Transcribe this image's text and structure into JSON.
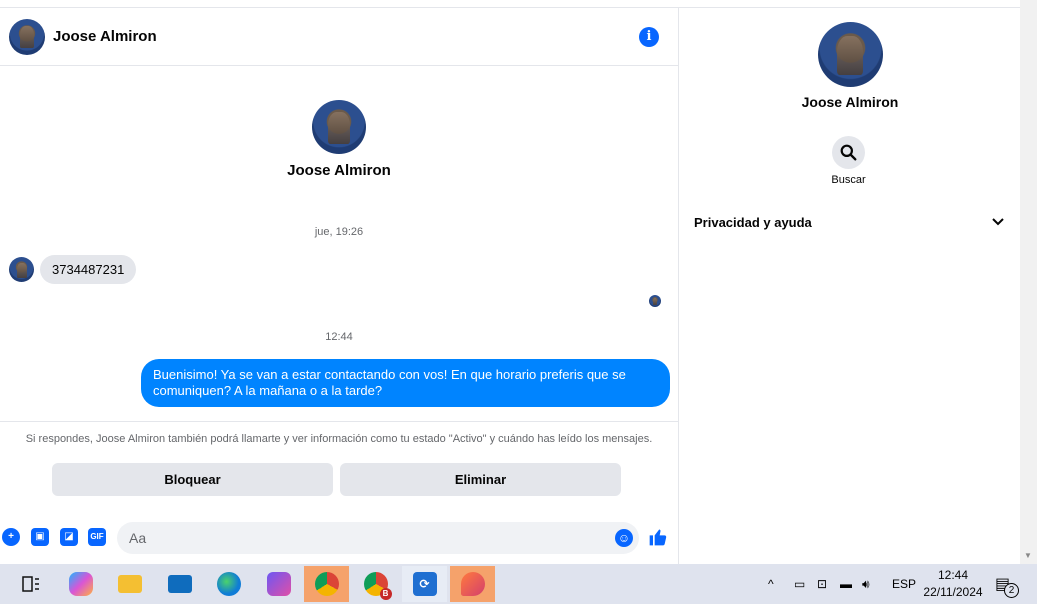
{
  "chat": {
    "contact_name": "Joose Almiron",
    "profile_name": "Joose Almiron",
    "timestamp_1": "jue, 19:26",
    "incoming_message": "3734487231",
    "timestamp_2": "12:44",
    "outgoing_message": "Buenisimo! Ya se van a estar contactando con vos! En que horario preferis que se comuniquen? A la mañana o a la tarde?",
    "notice": "Si respondes, Joose Almiron también podrá llamarte y ver información como tu estado \"Activo\" y cuándo has leído los mensajes.",
    "block_label": "Bloquear",
    "delete_label": "Eliminar",
    "input_placeholder": "Aa",
    "info_icon": "info-icon"
  },
  "sidebar": {
    "name": "Joose Almiron",
    "search_label": "Buscar",
    "privacy_label": "Privacidad y ayuda"
  },
  "composer_icons": [
    "plus-icon",
    "photo-icon",
    "sticker-icon",
    "gif-icon",
    "emoji-icon",
    "like-icon"
  ],
  "composer_gif_text": "GIF",
  "taskbar": {
    "apps": [
      "task-view",
      "copilot",
      "file-explorer",
      "mail",
      "edge",
      "office",
      "chrome-profile",
      "chrome-b",
      "app-sync",
      "paint"
    ],
    "chrome_badge": "B",
    "language": "ESP",
    "time": "12:44",
    "date": "22/11/2024",
    "notification_count": "2"
  },
  "colors": {
    "accent": "#0866ff",
    "outgoing_bubble": "#0084ff",
    "incoming_bubble": "#e4e6eb",
    "taskbar": "#dfe3ee",
    "taskbar_active": "#f5a26b"
  }
}
